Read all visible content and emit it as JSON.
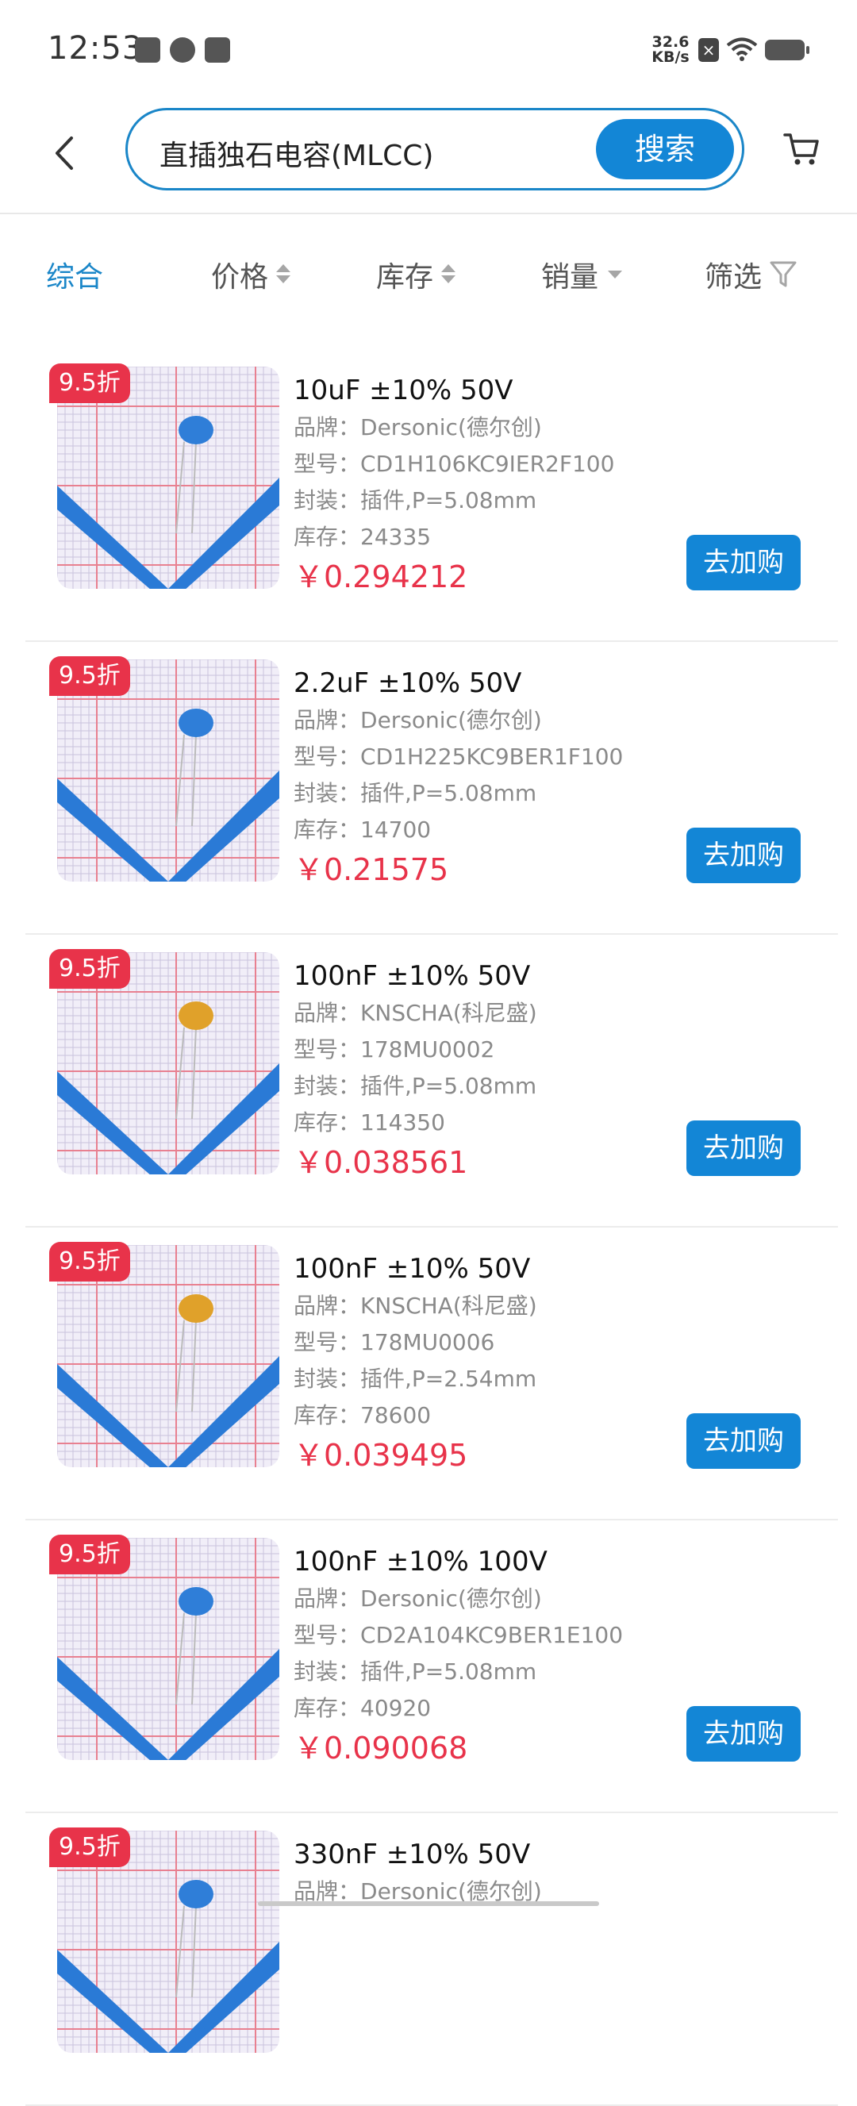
{
  "status_bar": {
    "time": "12:53",
    "net_speed": "32.6 KB/s"
  },
  "search": {
    "query": "直插独石电容(MLCC)",
    "button_label": "搜索"
  },
  "sort_tabs": [
    "综合",
    "价格",
    "库存",
    "销量",
    "筛选"
  ],
  "labels": {
    "brand": "品牌：",
    "model": "型号：",
    "package": "封装：",
    "stock": "库存："
  },
  "colors": {
    "accent": "#1386d6",
    "price": "#e8334a"
  },
  "products": [
    {
      "badge": "9.5折",
      "title": "10uF ±10% 50V",
      "brand": "Dersonic(德尔创)",
      "model": "CD1H106KC9IER2F100",
      "package": "插件,P=5.08mm",
      "stock": "24335",
      "price": "￥0.294212",
      "button": "去加购",
      "part_color": "#2f7ed8"
    },
    {
      "badge": "9.5折",
      "title": "2.2uF ±10% 50V",
      "brand": "Dersonic(德尔创)",
      "model": "CD1H225KC9BER1F100",
      "package": "插件,P=5.08mm",
      "stock": "14700",
      "price": "￥0.21575",
      "button": "去加购",
      "part_color": "#2f7ed8"
    },
    {
      "badge": "9.5折",
      "title": "100nF ±10% 50V",
      "brand": "KNSCHA(科尼盛)",
      "model": "178MU0002",
      "package": "插件,P=5.08mm",
      "stock": "114350",
      "price": "￥0.038561",
      "button": "去加购",
      "part_color": "#e0a12a"
    },
    {
      "badge": "9.5折",
      "title": "100nF ±10% 50V",
      "brand": "KNSCHA(科尼盛)",
      "model": "178MU0006",
      "package": "插件,P=2.54mm",
      "stock": "78600",
      "price": "￥0.039495",
      "button": "去加购",
      "part_color": "#e0a12a"
    },
    {
      "badge": "9.5折",
      "title": "100nF ±10% 100V",
      "brand": "Dersonic(德尔创)",
      "model": "CD2A104KC9BER1E100",
      "package": "插件,P=5.08mm",
      "stock": "40920",
      "price": "￥0.090068",
      "button": "去加购",
      "part_color": "#2f7ed8"
    },
    {
      "badge": "9.5折",
      "title": "330nF ±10% 50V",
      "brand": "Dersonic(德尔创)",
      "model": "",
      "package": "",
      "stock": "",
      "price": "",
      "button": "",
      "part_color": "#2f7ed8"
    }
  ]
}
